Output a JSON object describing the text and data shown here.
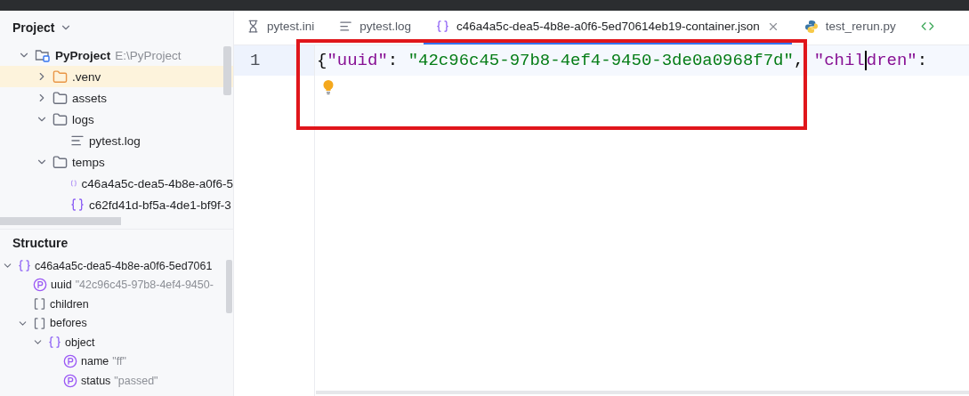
{
  "project_panel": {
    "title": "Project",
    "tree": [
      {
        "kind": "project",
        "name": "PyProject",
        "path": "E:\\PyProject",
        "expanded": true,
        "selected": false,
        "children": [
          {
            "kind": "excluded-folder",
            "name": ".venv",
            "expanded": false,
            "selected": true
          },
          {
            "kind": "folder",
            "name": "assets",
            "expanded": false,
            "selected": false
          },
          {
            "kind": "folder",
            "name": "logs",
            "expanded": true,
            "selected": false,
            "children": [
              {
                "kind": "log-file",
                "name": "pytest.log",
                "selected": false
              }
            ]
          },
          {
            "kind": "folder",
            "name": "temps",
            "expanded": true,
            "selected": false,
            "children": [
              {
                "kind": "json-file",
                "name": "c46a4a5c-dea5-4b8e-a0f6-5",
                "selected": false
              },
              {
                "kind": "json-file",
                "name": "c62fd41d-bf5a-4de1-bf9f-3",
                "selected": false
              }
            ]
          }
        ]
      }
    ]
  },
  "structure_panel": {
    "title": "Structure",
    "tree": [
      {
        "kind": "object",
        "name": "c46a4a5c-dea5-4b8e-a0f6-5ed7061",
        "expanded": true,
        "children": [
          {
            "kind": "property",
            "name": "uuid",
            "value": "\"42c96c45-97b8-4ef4-9450-"
          },
          {
            "kind": "array",
            "name": "children"
          },
          {
            "kind": "array",
            "name": "befores",
            "expanded": true,
            "children": [
              {
                "kind": "object",
                "name": "object",
                "expanded": true,
                "children": [
                  {
                    "kind": "property",
                    "name": "name",
                    "value": "\"ff\""
                  },
                  {
                    "kind": "property",
                    "name": "status",
                    "value": "\"passed\""
                  }
                ]
              }
            ]
          }
        ]
      }
    ]
  },
  "tabs": [
    {
      "kind": "ini",
      "label": "pytest.ini",
      "selected": false,
      "closable": false
    },
    {
      "kind": "log",
      "label": "pytest.log",
      "selected": false,
      "closable": false
    },
    {
      "kind": "json",
      "label": "c46a4a5c-dea5-4b8e-a0f6-5ed70614eb19-container.json",
      "selected": true,
      "closable": true
    },
    {
      "kind": "python",
      "label": "test_rerun.py",
      "selected": false,
      "closable": false
    },
    {
      "kind": "more",
      "selected": false,
      "closable": false
    }
  ],
  "editor": {
    "lines": [
      {
        "number": "1",
        "current": true,
        "tokens": [
          {
            "kind": "punct",
            "text": "{"
          },
          {
            "kind": "key",
            "text": "\"uuid\""
          },
          {
            "kind": "punct",
            "text": ": "
          },
          {
            "kind": "string",
            "text": "\"42c96c45-97b8-4ef4-9450-3de0a0968f7d\""
          },
          {
            "kind": "punct",
            "text": ", "
          },
          {
            "kind": "key",
            "text": "\"chil"
          },
          {
            "kind": "cursor"
          },
          {
            "kind": "key",
            "text": "dren\""
          },
          {
            "kind": "punct",
            "text": ":"
          }
        ]
      }
    ],
    "intention_bulb": true,
    "annotation": true
  }
}
